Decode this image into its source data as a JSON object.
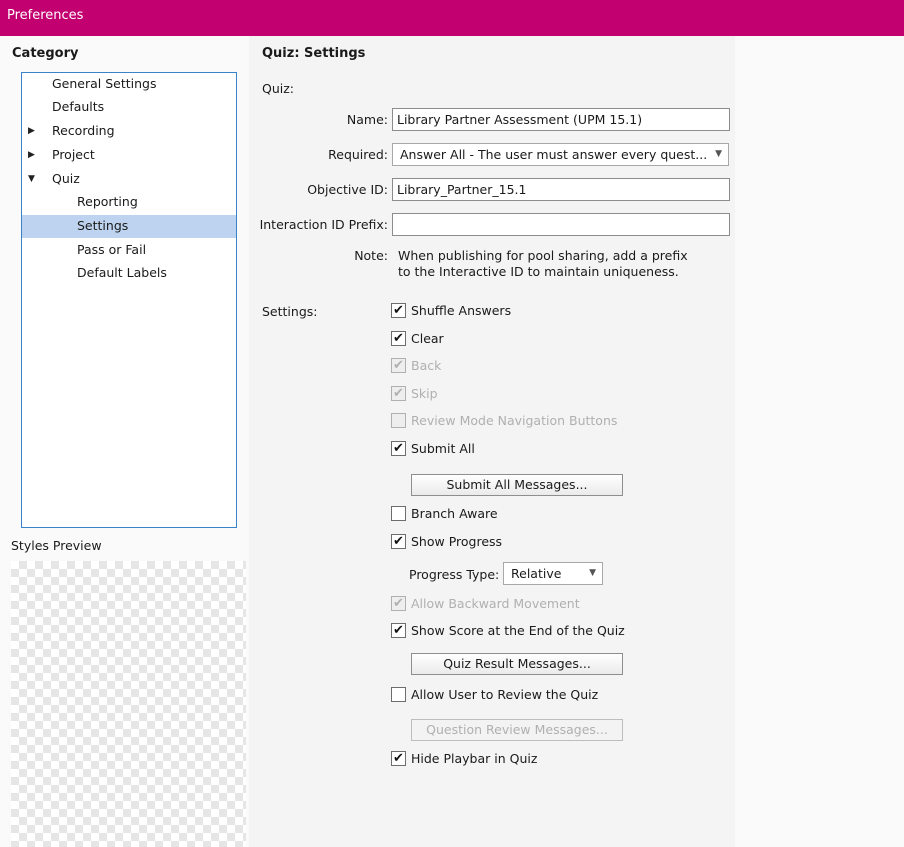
{
  "window": {
    "title": "Preferences"
  },
  "category": {
    "heading": "Category",
    "items": [
      {
        "label": "General Settings",
        "arrow": ""
      },
      {
        "label": "Defaults",
        "arrow": ""
      },
      {
        "label": "Recording",
        "arrow": "▶"
      },
      {
        "label": "Project",
        "arrow": "▶"
      },
      {
        "label": "Quiz",
        "arrow": "▼"
      },
      {
        "label": "Reporting",
        "arrow": ""
      },
      {
        "label": "Settings",
        "arrow": "",
        "selected": true
      },
      {
        "label": "Pass or Fail",
        "arrow": ""
      },
      {
        "label": "Default Labels",
        "arrow": ""
      }
    ]
  },
  "styles_preview": {
    "label": "Styles Preview"
  },
  "panel": {
    "title": "Quiz: Settings",
    "quiz_section_label": "Quiz:",
    "name": {
      "label": "Name:",
      "value": "Library Partner Assessment (UPM 15.1)"
    },
    "required": {
      "label": "Required:",
      "value": "Answer All - The user must answer every quest..."
    },
    "objective_id": {
      "label": "Objective ID:",
      "value": "Library_Partner_15.1"
    },
    "interaction_id_prefix": {
      "label": "Interaction ID Prefix:",
      "value": ""
    },
    "note": {
      "label": "Note:",
      "line1": "When publishing for pool sharing, add a prefix",
      "line2": "to the Interactive ID to maintain uniqueness."
    },
    "settings_label": "Settings:",
    "options": {
      "shuffle_answers": {
        "label": "Shuffle Answers",
        "checked": true,
        "enabled": true
      },
      "clear": {
        "label": "Clear",
        "checked": true,
        "enabled": true
      },
      "back": {
        "label": "Back",
        "checked": true,
        "enabled": false
      },
      "skip": {
        "label": "Skip",
        "checked": true,
        "enabled": false
      },
      "review_nav": {
        "label": "Review Mode Navigation Buttons",
        "checked": false,
        "enabled": false
      },
      "submit_all": {
        "label": "Submit All",
        "checked": true,
        "enabled": true
      },
      "branch_aware": {
        "label": "Branch Aware",
        "checked": false,
        "enabled": true
      },
      "show_progress": {
        "label": "Show Progress",
        "checked": true,
        "enabled": true
      },
      "allow_backward": {
        "label": "Allow Backward Movement",
        "checked": true,
        "enabled": false
      },
      "show_score": {
        "label": "Show Score at the End of the Quiz",
        "checked": true,
        "enabled": true
      },
      "allow_review": {
        "label": "Allow User to Review the Quiz",
        "checked": false,
        "enabled": true
      },
      "hide_playbar": {
        "label": "Hide Playbar in Quiz",
        "checked": true,
        "enabled": true
      }
    },
    "buttons": {
      "submit_all_messages": "Submit All Messages...",
      "quiz_result_messages": "Quiz Result Messages...",
      "question_review_messages": "Question Review Messages..."
    },
    "progress_type": {
      "label": "Progress Type:",
      "value": "Relative"
    }
  },
  "icons": {
    "checkmark": "✔",
    "collapsed": "▶",
    "expanded": "▼",
    "dropdown": "▼"
  },
  "colors": {
    "titlebar": "#c3006f",
    "selection": "#bed3ef",
    "tree_border": "#3a83c9"
  }
}
